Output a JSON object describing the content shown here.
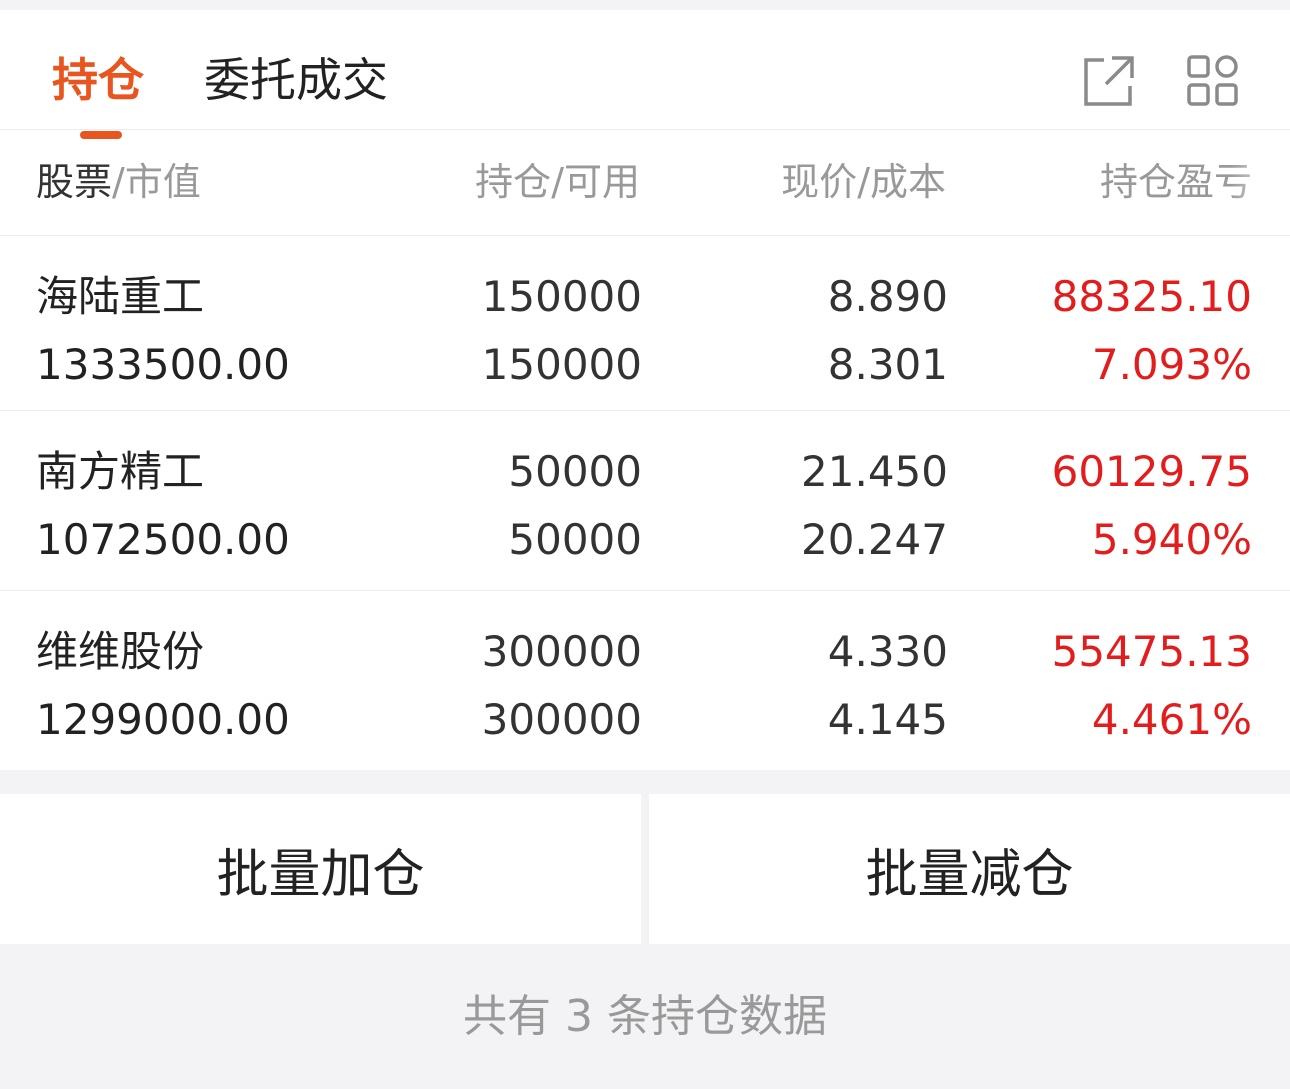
{
  "tabs": {
    "active": "持仓",
    "inactive": "委托成交"
  },
  "icons": {
    "export": "export-icon",
    "grid": "grid-icon"
  },
  "colors": {
    "accent": "#e8551f",
    "profit": "#e31d1d"
  },
  "columns": {
    "stock": "股票",
    "stock_sub": "/市值",
    "position": "持仓",
    "position_sub": "/可用",
    "price": "现价",
    "price_sub": "/成本",
    "pl": "持仓盈亏"
  },
  "holdings": [
    {
      "name": "海陆重工",
      "market_value": "1333500.00",
      "position": "150000",
      "available": "150000",
      "price": "8.890",
      "cost": "8.301",
      "pl": "88325.10",
      "pl_pct": "7.093%"
    },
    {
      "name": "南方精工",
      "market_value": "1072500.00",
      "position": "50000",
      "available": "50000",
      "price": "21.450",
      "cost": "20.247",
      "pl": "60129.75",
      "pl_pct": "5.940%"
    },
    {
      "name": "维维股份",
      "market_value": "1299000.00",
      "position": "300000",
      "available": "300000",
      "price": "4.330",
      "cost": "4.145",
      "pl": "55475.13",
      "pl_pct": "4.461%"
    }
  ],
  "actions": {
    "batch_add": "批量加仓",
    "batch_reduce": "批量减仓"
  },
  "footer": "共有 3 条持仓数据"
}
